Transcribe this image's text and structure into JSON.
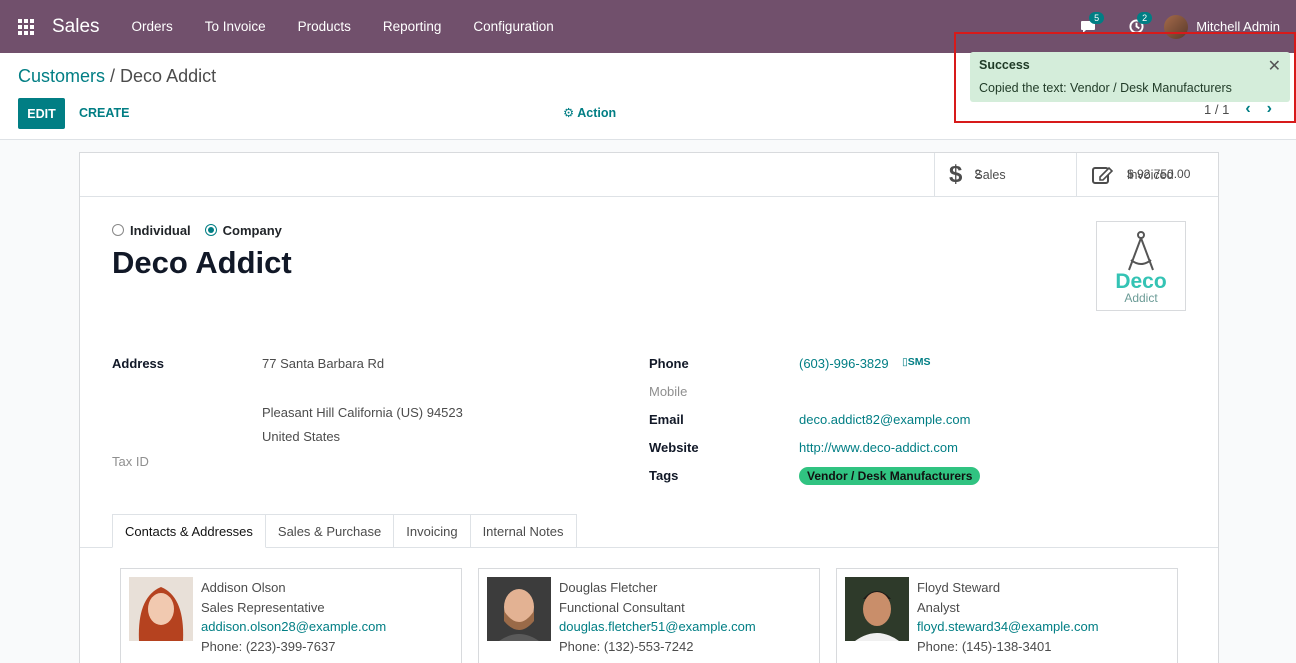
{
  "navbar": {
    "app_name": "Sales",
    "menu": [
      "Orders",
      "To Invoice",
      "Products",
      "Reporting",
      "Configuration"
    ],
    "messages_count": "5",
    "activities_count": "2",
    "user_name": "Mitchell Admin"
  },
  "control_panel": {
    "breadcrumb_parent": "Customers",
    "breadcrumb_separator": " / ",
    "breadcrumb_current": "Deco Addict",
    "edit_label": "EDIT",
    "create_label": "CREATE",
    "action_label": "Action",
    "pager_value": "1 / 1"
  },
  "smart_buttons": {
    "sales_value": "2",
    "sales_label": "Sales",
    "invoiced_value": "$ 92,750.00",
    "invoiced_label": "Invoiced"
  },
  "form": {
    "type_individual": "Individual",
    "type_company": "Company",
    "selected_type": "Company",
    "name": "Deco Addict",
    "logo_word": "Deco",
    "logo_sub": "Addict",
    "address_label": "Address",
    "street": "77 Santa Barbara Rd",
    "city_line": "Pleasant Hill  California (US)  94523",
    "country": "United States",
    "tax_id_label": "Tax ID",
    "phone_label": "Phone",
    "phone": "(603)-996-3829",
    "sms_label": "SMS",
    "mobile_label": "Mobile",
    "email_label": "Email",
    "email": "deco.addict82@example.com",
    "website_label": "Website",
    "website": "http://www.deco-addict.com",
    "tags_label": "Tags",
    "tag": "Vendor / Desk Manufacturers"
  },
  "tabs": [
    "Contacts & Addresses",
    "Sales & Purchase",
    "Invoicing",
    "Internal Notes"
  ],
  "contacts": [
    {
      "name": "Addison Olson",
      "role": "Sales Representative",
      "email": "addison.olson28@example.com",
      "phone": "Phone: (223)-399-7637"
    },
    {
      "name": "Douglas Fletcher",
      "role": "Functional Consultant",
      "email": "douglas.fletcher51@example.com",
      "phone": "Phone: (132)-553-7242"
    },
    {
      "name": "Floyd Steward",
      "role": "Analyst",
      "email": "floyd.steward34@example.com",
      "phone": "Phone: (145)-138-3401"
    }
  ],
  "toast": {
    "title": "Success",
    "message": "Copied the text: Vendor / Desk Manufacturers"
  },
  "colors": {
    "navbar": "#71506c",
    "accent": "#017e84",
    "tag": "#30c381",
    "toast_bg": "#d4edda",
    "highlight_box": "#d71a1a"
  }
}
